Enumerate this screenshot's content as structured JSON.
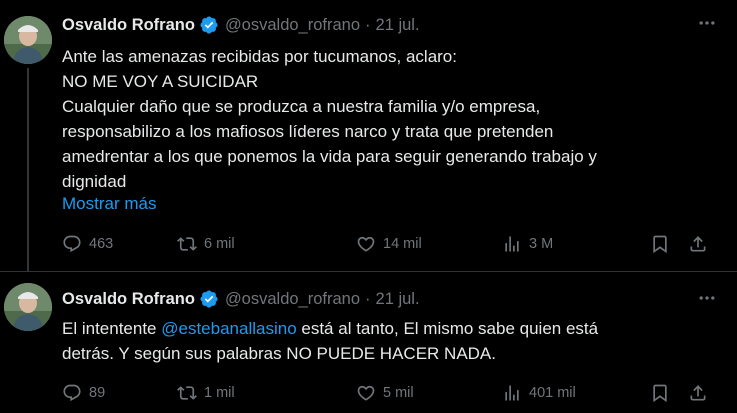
{
  "tweets": [
    {
      "author_name": "Osvaldo Rofrano",
      "handle": "@osvaldo_rofrano",
      "dot": "·",
      "date": "21 jul.",
      "text_lines": [
        "Ante las amenazas recibidas por tucumanos, aclaro:",
        "NO ME VOY A SUICIDAR",
        "Cualquier daño que se produzca a nuestra familia y/o empresa,",
        "responsabilizo a los mafiosos líderes narco y trata que pretenden",
        "amedrentar a los que ponemos la vida para seguir generando trabajo y",
        "dignidad"
      ],
      "show_more": "Mostrar más",
      "replies": "463",
      "reposts": "6 mil",
      "likes": "14 mil",
      "views": "3 M"
    },
    {
      "author_name": "Osvaldo Rofrano",
      "handle": "@osvaldo_rofrano",
      "dot": "·",
      "date": "21 jul.",
      "text_pre": "El intentente ",
      "mention": "@estebanallasino",
      "text_post": " está al tanto, El mismo sabe quien está\ndetrás. Y según sus palabras NO PUEDE HACER NADA.",
      "replies": "89",
      "reposts": "1 mil",
      "likes": "5 mil",
      "views": "401 mil"
    }
  ],
  "colors": {
    "background": "#000000",
    "text": "#e7e9ea",
    "muted": "#71767b",
    "link": "#1d9bf0",
    "verified": "#1d9bf0"
  }
}
